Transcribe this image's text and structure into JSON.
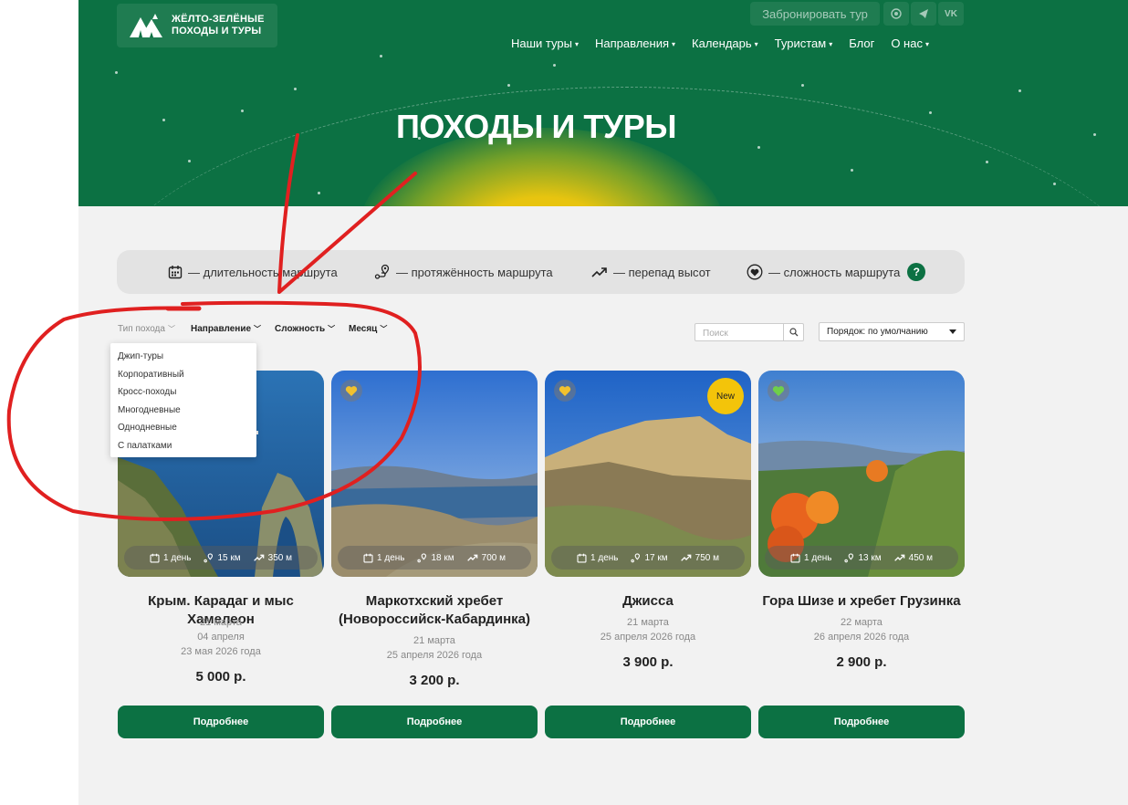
{
  "header": {
    "logo_line1": "ЖЁЛТО-ЗЕЛЁНЫЕ",
    "logo_line2": "ПОХОДЫ И ТУРЫ",
    "book_label": "Забронировать тур",
    "socials": [
      "whatsapp-icon",
      "telegram-icon",
      "vk-icon"
    ],
    "vk_label": "VK",
    "nav": [
      {
        "label": "Наши туры",
        "caret": true
      },
      {
        "label": "Направления",
        "caret": true
      },
      {
        "label": "Календарь",
        "caret": true
      },
      {
        "label": "Туристам",
        "caret": true
      },
      {
        "label": "Блог",
        "caret": false
      },
      {
        "label": "О нас",
        "caret": true
      }
    ],
    "hero_title": "ПОХОДЫ И ТУРЫ"
  },
  "legend": {
    "duration": "— длительность маршрута",
    "distance": "— протяжённость маршрута",
    "elevation": "— перепад высот",
    "difficulty": "— сложность маршрута",
    "help": "?"
  },
  "filters": {
    "type": "Тип похода",
    "direction": "Направление",
    "difficulty": "Сложность",
    "month": "Месяц",
    "search_placeholder": "Поиск",
    "sort": "Порядок: по умолчанию",
    "type_options": [
      "Джип-туры",
      "Корпоративный",
      "Кросс-походы",
      "Многодневные",
      "Однодневные",
      "С палатками"
    ]
  },
  "cards": [
    {
      "title": "Крым. Карадаг и мыс Хамелеон",
      "dates": [
        "21 марта",
        "04 апреля",
        "23 мая 2026 года"
      ],
      "price": "5 000 р.",
      "days": "1 день",
      "km": "15 км",
      "elev": "350 м",
      "heart": null,
      "new": null,
      "button": "Подробнее"
    },
    {
      "title": "Маркотхский хребет (Новороссийск-Кабардинка)",
      "dates": [
        "21 марта",
        "25 апреля 2026 года"
      ],
      "price": "3 200 р.",
      "days": "1 день",
      "km": "18 км",
      "elev": "700 м",
      "heart": "#f2c12e",
      "new": null,
      "button": "Подробнее"
    },
    {
      "title": "Джисса",
      "dates": [
        "21 марта",
        "25 апреля 2026 года"
      ],
      "price": "3 900 р.",
      "days": "1 день",
      "km": "17 км",
      "elev": "750 м",
      "heart": "#f2c12e",
      "new": "New",
      "button": "Подробнее"
    },
    {
      "title": "Гора Шизе и хребет Грузинка",
      "dates": [
        "22 марта",
        "26 апреля 2026 года"
      ],
      "price": "2 900 р.",
      "days": "1 день",
      "km": "13 км",
      "elev": "450 м",
      "heart": "#6fcf4a",
      "new": null,
      "button": "Подробнее"
    }
  ],
  "colors": {
    "brand_green": "#0c7143",
    "accent_yellow": "#f3c40a",
    "annotation_red": "#e02020"
  }
}
